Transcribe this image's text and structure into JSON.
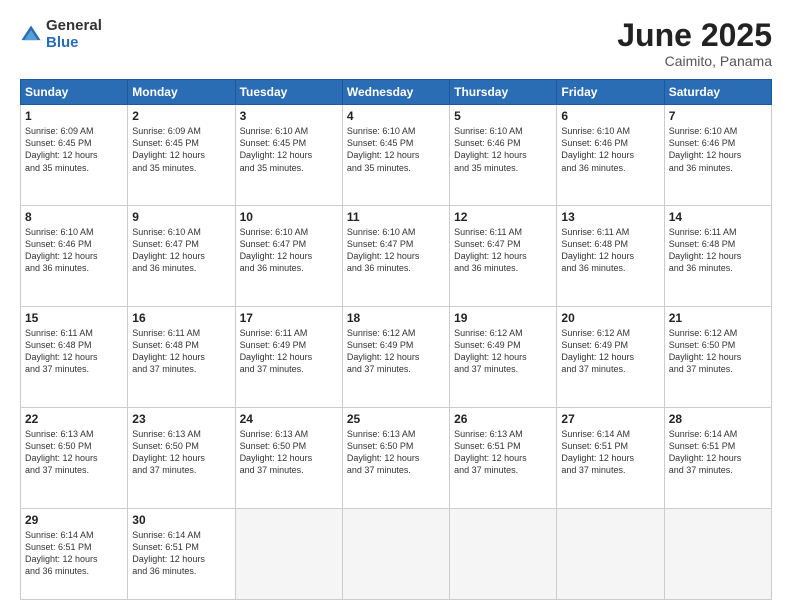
{
  "logo": {
    "general": "General",
    "blue": "Blue"
  },
  "header": {
    "month": "June 2025",
    "location": "Caimito, Panama"
  },
  "weekdays": [
    "Sunday",
    "Monday",
    "Tuesday",
    "Wednesday",
    "Thursday",
    "Friday",
    "Saturday"
  ],
  "weeks": [
    [
      {
        "day": "1",
        "info": "Sunrise: 6:09 AM\nSunset: 6:45 PM\nDaylight: 12 hours\nand 35 minutes."
      },
      {
        "day": "2",
        "info": "Sunrise: 6:09 AM\nSunset: 6:45 PM\nDaylight: 12 hours\nand 35 minutes."
      },
      {
        "day": "3",
        "info": "Sunrise: 6:10 AM\nSunset: 6:45 PM\nDaylight: 12 hours\nand 35 minutes."
      },
      {
        "day": "4",
        "info": "Sunrise: 6:10 AM\nSunset: 6:45 PM\nDaylight: 12 hours\nand 35 minutes."
      },
      {
        "day": "5",
        "info": "Sunrise: 6:10 AM\nSunset: 6:46 PM\nDaylight: 12 hours\nand 35 minutes."
      },
      {
        "day": "6",
        "info": "Sunrise: 6:10 AM\nSunset: 6:46 PM\nDaylight: 12 hours\nand 36 minutes."
      },
      {
        "day": "7",
        "info": "Sunrise: 6:10 AM\nSunset: 6:46 PM\nDaylight: 12 hours\nand 36 minutes."
      }
    ],
    [
      {
        "day": "8",
        "info": "Sunrise: 6:10 AM\nSunset: 6:46 PM\nDaylight: 12 hours\nand 36 minutes."
      },
      {
        "day": "9",
        "info": "Sunrise: 6:10 AM\nSunset: 6:47 PM\nDaylight: 12 hours\nand 36 minutes."
      },
      {
        "day": "10",
        "info": "Sunrise: 6:10 AM\nSunset: 6:47 PM\nDaylight: 12 hours\nand 36 minutes."
      },
      {
        "day": "11",
        "info": "Sunrise: 6:10 AM\nSunset: 6:47 PM\nDaylight: 12 hours\nand 36 minutes."
      },
      {
        "day": "12",
        "info": "Sunrise: 6:11 AM\nSunset: 6:47 PM\nDaylight: 12 hours\nand 36 minutes."
      },
      {
        "day": "13",
        "info": "Sunrise: 6:11 AM\nSunset: 6:48 PM\nDaylight: 12 hours\nand 36 minutes."
      },
      {
        "day": "14",
        "info": "Sunrise: 6:11 AM\nSunset: 6:48 PM\nDaylight: 12 hours\nand 36 minutes."
      }
    ],
    [
      {
        "day": "15",
        "info": "Sunrise: 6:11 AM\nSunset: 6:48 PM\nDaylight: 12 hours\nand 37 minutes."
      },
      {
        "day": "16",
        "info": "Sunrise: 6:11 AM\nSunset: 6:48 PM\nDaylight: 12 hours\nand 37 minutes."
      },
      {
        "day": "17",
        "info": "Sunrise: 6:11 AM\nSunset: 6:49 PM\nDaylight: 12 hours\nand 37 minutes."
      },
      {
        "day": "18",
        "info": "Sunrise: 6:12 AM\nSunset: 6:49 PM\nDaylight: 12 hours\nand 37 minutes."
      },
      {
        "day": "19",
        "info": "Sunrise: 6:12 AM\nSunset: 6:49 PM\nDaylight: 12 hours\nand 37 minutes."
      },
      {
        "day": "20",
        "info": "Sunrise: 6:12 AM\nSunset: 6:49 PM\nDaylight: 12 hours\nand 37 minutes."
      },
      {
        "day": "21",
        "info": "Sunrise: 6:12 AM\nSunset: 6:50 PM\nDaylight: 12 hours\nand 37 minutes."
      }
    ],
    [
      {
        "day": "22",
        "info": "Sunrise: 6:13 AM\nSunset: 6:50 PM\nDaylight: 12 hours\nand 37 minutes."
      },
      {
        "day": "23",
        "info": "Sunrise: 6:13 AM\nSunset: 6:50 PM\nDaylight: 12 hours\nand 37 minutes."
      },
      {
        "day": "24",
        "info": "Sunrise: 6:13 AM\nSunset: 6:50 PM\nDaylight: 12 hours\nand 37 minutes."
      },
      {
        "day": "25",
        "info": "Sunrise: 6:13 AM\nSunset: 6:50 PM\nDaylight: 12 hours\nand 37 minutes."
      },
      {
        "day": "26",
        "info": "Sunrise: 6:13 AM\nSunset: 6:51 PM\nDaylight: 12 hours\nand 37 minutes."
      },
      {
        "day": "27",
        "info": "Sunrise: 6:14 AM\nSunset: 6:51 PM\nDaylight: 12 hours\nand 37 minutes."
      },
      {
        "day": "28",
        "info": "Sunrise: 6:14 AM\nSunset: 6:51 PM\nDaylight: 12 hours\nand 37 minutes."
      }
    ],
    [
      {
        "day": "29",
        "info": "Sunrise: 6:14 AM\nSunset: 6:51 PM\nDaylight: 12 hours\nand 36 minutes."
      },
      {
        "day": "30",
        "info": "Sunrise: 6:14 AM\nSunset: 6:51 PM\nDaylight: 12 hours\nand 36 minutes."
      },
      null,
      null,
      null,
      null,
      null
    ]
  ]
}
